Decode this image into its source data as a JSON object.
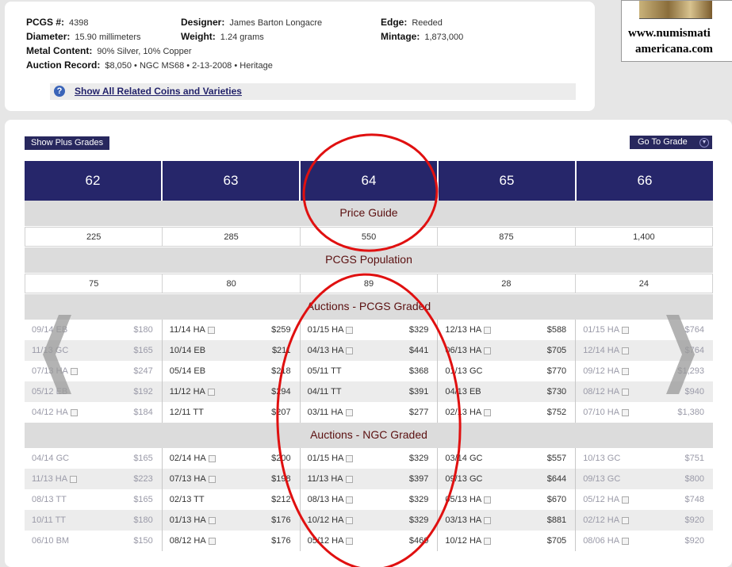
{
  "coin_info": {
    "pcgs_label": "PCGS #:",
    "pcgs_value": "4398",
    "designer_label": "Designer:",
    "designer_value": "James Barton Longacre",
    "edge_label": "Edge:",
    "edge_value": "Reeded",
    "diameter_label": "Diameter:",
    "diameter_value": "15.90 millimeters",
    "weight_label": "Weight:",
    "weight_value": "1.24 grams",
    "mintage_label": "Mintage:",
    "mintage_value": "1,873,000",
    "metal_label": "Metal Content:",
    "metal_value": "90% Silver, 10% Copper",
    "auction_label": "Auction Record:",
    "auction_value": "$8,050 • NGC MS68 • 2-13-2008 • Heritage",
    "related_link": "Show All Related Coins and Varieties",
    "help_glyph": "?"
  },
  "ad": {
    "line1": "www.numismati",
    "line2": "americana.com"
  },
  "controls": {
    "show_plus": "Show Plus Grades",
    "go_to_grade": "Go To Grade"
  },
  "grades": [
    "62",
    "63",
    "64",
    "65",
    "66"
  ],
  "price_guide": {
    "title": "Price Guide",
    "values": [
      "225",
      "285",
      "550",
      "875",
      "1,400"
    ]
  },
  "population": {
    "title": "PCGS Population",
    "values": [
      "75",
      "80",
      "89",
      "28",
      "24"
    ]
  },
  "pcgs_auctions": {
    "title": "Auctions - PCGS Graded",
    "rows": [
      [
        [
          "09/14 EB",
          "$180"
        ],
        [
          "11/14 HA",
          "$259"
        ],
        [
          "01/15 HA",
          "$329"
        ],
        [
          "12/13 HA",
          "$588"
        ],
        [
          "01/15 HA",
          "$764"
        ]
      ],
      [
        [
          "11/13 GC",
          "$165"
        ],
        [
          "10/14 EB",
          "$211"
        ],
        [
          "04/13 HA",
          "$441"
        ],
        [
          "06/13 HA",
          "$705"
        ],
        [
          "12/14 HA",
          "$764"
        ]
      ],
      [
        [
          "07/13 HA",
          "$247"
        ],
        [
          "05/14 EB",
          "$218"
        ],
        [
          "05/11 TT",
          "$368"
        ],
        [
          "01/13 GC",
          "$770"
        ],
        [
          "09/12 HA",
          "$1,293"
        ]
      ],
      [
        [
          "05/12 EB",
          "$192"
        ],
        [
          "11/12 HA",
          "$294"
        ],
        [
          "04/11 TT",
          "$391"
        ],
        [
          "04/13 EB",
          "$730"
        ],
        [
          "08/12 HA",
          "$940"
        ]
      ],
      [
        [
          "04/12 HA",
          "$184"
        ],
        [
          "12/11 TT",
          "$207"
        ],
        [
          "03/11 HA",
          "$277"
        ],
        [
          "02/13 HA",
          "$752"
        ],
        [
          "07/10 HA",
          "$1,380"
        ]
      ]
    ]
  },
  "ngc_auctions": {
    "title": "Auctions - NGC Graded",
    "rows": [
      [
        [
          "04/14 GC",
          "$165"
        ],
        [
          "02/14 HA",
          "$200"
        ],
        [
          "01/15 HA",
          "$329"
        ],
        [
          "03/14 GC",
          "$557"
        ],
        [
          "10/13 GC",
          "$751"
        ]
      ],
      [
        [
          "11/13 HA",
          "$223"
        ],
        [
          "07/13 HA",
          "$198"
        ],
        [
          "11/13 HA",
          "$397"
        ],
        [
          "09/13 GC",
          "$644"
        ],
        [
          "09/13 GC",
          "$800"
        ]
      ],
      [
        [
          "08/13 TT",
          "$165"
        ],
        [
          "02/13 TT",
          "$212"
        ],
        [
          "08/13 HA",
          "$329"
        ],
        [
          "05/13 HA",
          "$670"
        ],
        [
          "05/12 HA",
          "$748"
        ]
      ],
      [
        [
          "10/11 TT",
          "$180"
        ],
        [
          "01/13 HA",
          "$176"
        ],
        [
          "10/12 HA",
          "$329"
        ],
        [
          "03/13 HA",
          "$881"
        ],
        [
          "02/12 HA",
          "$920"
        ]
      ],
      [
        [
          "06/10 BM",
          "$150"
        ],
        [
          "08/12 HA",
          "$176"
        ],
        [
          "05/12 HA",
          "$460"
        ],
        [
          "10/12 HA",
          "$705"
        ],
        [
          "08/06 HA",
          "$920"
        ]
      ]
    ]
  },
  "colors": {
    "header_navy": "#26266a",
    "section_gray": "#dcdcdc",
    "annotation_red": "#e01010",
    "title_maroon": "#5b1010"
  }
}
